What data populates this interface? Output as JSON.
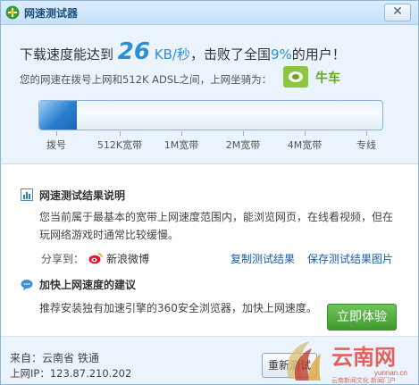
{
  "window": {
    "title": "网速测试器",
    "close_glyph": "✕"
  },
  "summary": {
    "prefix": "下载速度能达到",
    "speed": "26",
    "unit": "KB/秒",
    "mid": "，击败了全国",
    "percent": "9%",
    "suffix": "的用户！",
    "description": "您的网速在拨号上网和512K ADSL之间，上网坐骑为：",
    "mount": "牛车"
  },
  "progress": {
    "fill_fraction": 0.11,
    "labels": [
      "拨号",
      "512K宽带",
      "1M宽带",
      "2M宽带",
      "4M宽带",
      "专线"
    ]
  },
  "results": {
    "title": "网速测试结果说明",
    "paragraph": "您当前属于最基本的宽带上网速度范围内，能浏览网页，在线看视频，但在玩网络游戏时通常比较缓慢。",
    "share_label": "分享到：",
    "weibo": "新浪微博",
    "copy_link": "复制测试结果",
    "save_link": "保存测试结果图片"
  },
  "advice": {
    "title": "加快上网速度的建议",
    "text": "推荐安装独有加速引擎的360安全浏览器，加快上网速度。",
    "button": "立即体验"
  },
  "footer": {
    "from": "来自：云南省 铁通",
    "ip": "上网IP：123.87.210.202",
    "retest": "重新测试"
  },
  "watermark": {
    "text": "云南网",
    "url": "yunnan.cn",
    "tagline": "云南新闻文化 新闻门户"
  },
  "colors": {
    "accent": "#2a8fd6",
    "green": "#6aa51a",
    "link": "#1a5ea8"
  }
}
